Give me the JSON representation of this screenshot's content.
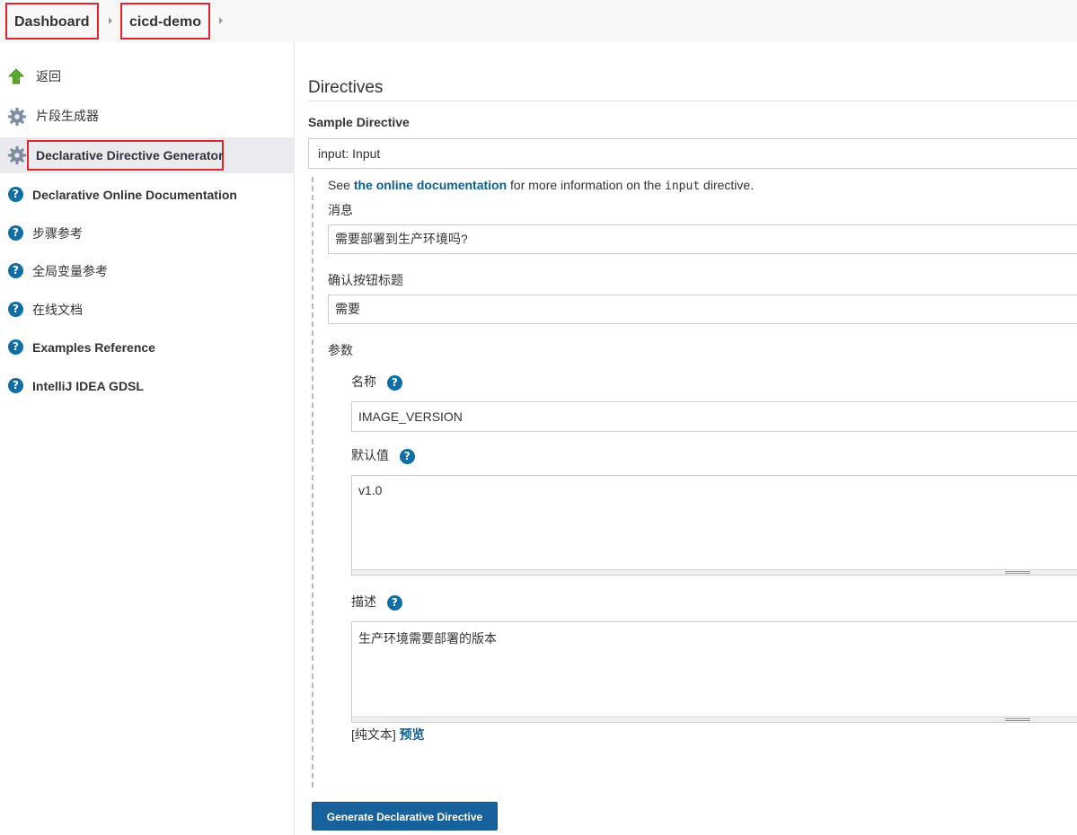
{
  "breadcrumb": {
    "items": [
      {
        "label": "Dashboard"
      },
      {
        "label": "cicd-demo"
      }
    ]
  },
  "sidebar": {
    "items": [
      {
        "label": "返回",
        "icon": "up-arrow-icon"
      },
      {
        "label": "片段生成器",
        "icon": "gear-icon"
      },
      {
        "label": "Declarative Directive Generator",
        "icon": "gear-icon",
        "active": true
      },
      {
        "label": "Declarative Online Documentation",
        "icon": "help-icon"
      },
      {
        "label": "步骤参考",
        "icon": "help-icon"
      },
      {
        "label": "全局变量参考",
        "icon": "help-icon"
      },
      {
        "label": "在线文档",
        "icon": "help-icon"
      },
      {
        "label": "Examples Reference",
        "icon": "help-icon"
      },
      {
        "label": "IntelliJ IDEA GDSL",
        "icon": "help-icon"
      }
    ]
  },
  "main": {
    "title": "Directives",
    "sample_label": "Sample Directive",
    "sample_value": "input: Input",
    "doc_note": {
      "prefix": "See ",
      "link": "the online documentation",
      "middle": " for more information on the ",
      "code": "input",
      "suffix": " directive."
    },
    "message": {
      "label": "消息",
      "value": "需要部署到生产环境吗?"
    },
    "ok": {
      "label": "确认按钮标题",
      "value": "需要"
    },
    "params_label": "参数",
    "param_name": {
      "label": "名称",
      "value": "IMAGE_VERSION"
    },
    "param_default": {
      "label": "默认值",
      "value": "v1.0"
    },
    "param_desc": {
      "label": "描述",
      "value": "生产环境需要部署的版本"
    },
    "format": {
      "plain": "[纯文本]",
      "preview": "预览"
    },
    "generate_button": "Generate Declarative Directive"
  },
  "colors": {
    "accent": "#17629c",
    "link": "#0e5f8f",
    "highlight_box": "#e0262b",
    "help_icon": "#0f6ea5"
  }
}
